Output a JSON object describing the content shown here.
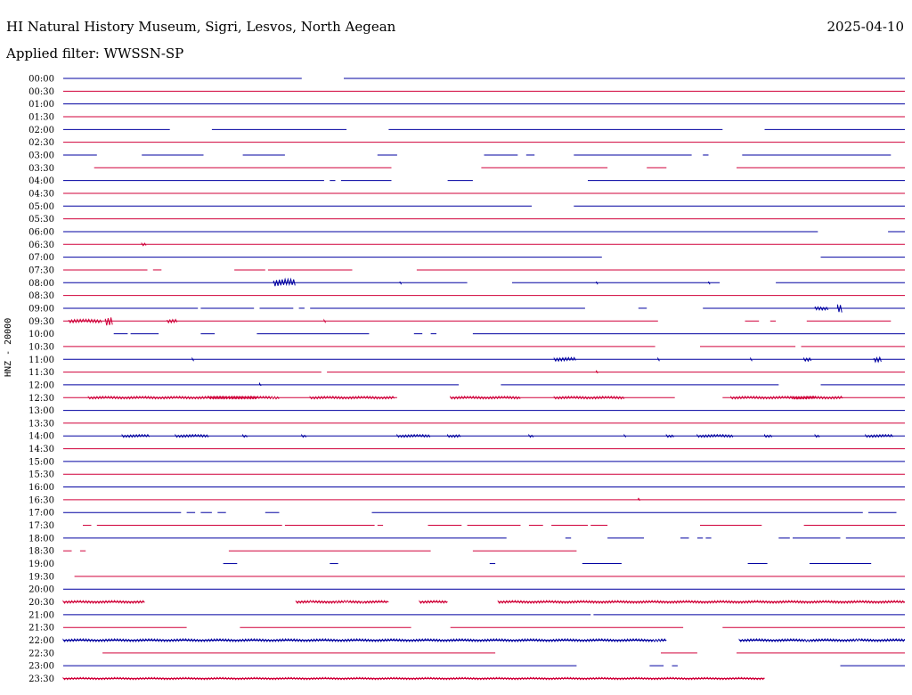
{
  "header": {
    "station": "HI Natural History Museum, Sigri, Lesvos, North Aegean",
    "date": "2025-04-10",
    "filter": "Applied filter: WWSSN-SP"
  },
  "colors": {
    "odd_row": "#0000a0",
    "even_row": "#d0003a"
  },
  "chart_data": {
    "type": "line",
    "title": "HI Natural History Museum, Sigri, Lesvos, North Aegean",
    "date": "2025-04-10",
    "ylabel": "HNZ - 20000",
    "x_range_minutes": [
      0,
      30
    ],
    "rows": [
      {
        "label": "00:00",
        "segments": [
          [
            0,
            8.5
          ],
          [
            10,
            30
          ]
        ],
        "bursts": []
      },
      {
        "label": "00:30",
        "segments": [
          [
            0,
            30
          ]
        ],
        "bursts": []
      },
      {
        "label": "01:00",
        "segments": [
          [
            0,
            30
          ]
        ],
        "bursts": []
      },
      {
        "label": "01:30",
        "segments": [
          [
            0,
            30
          ]
        ],
        "bursts": []
      },
      {
        "label": "02:00",
        "segments": [
          [
            0,
            3.8
          ],
          [
            5.3,
            10.1
          ],
          [
            11.6,
            23.5
          ],
          [
            25,
            30
          ]
        ],
        "bursts": []
      },
      {
        "label": "02:30",
        "segments": [
          [
            0,
            30
          ]
        ],
        "bursts": []
      },
      {
        "label": "03:00",
        "segments": [
          [
            0,
            1.2
          ],
          [
            2.8,
            5
          ],
          [
            6.4,
            7.9
          ],
          [
            11.2,
            11.9
          ],
          [
            15,
            16.2
          ],
          [
            16.5,
            16.8
          ],
          [
            18.2,
            22.4
          ],
          [
            22.8,
            23
          ],
          [
            24.2,
            29.5
          ]
        ],
        "bursts": []
      },
      {
        "label": "03:30",
        "segments": [
          [
            1.1,
            11.7
          ],
          [
            14.9,
            19.4
          ],
          [
            20.8,
            21.5
          ],
          [
            24,
            30
          ]
        ],
        "bursts": []
      },
      {
        "label": "04:00",
        "segments": [
          [
            0,
            9.3
          ],
          [
            9.5,
            9.7
          ],
          [
            9.9,
            11.7
          ],
          [
            13.7,
            14.6
          ],
          [
            18.7,
            30
          ]
        ],
        "bursts": []
      },
      {
        "label": "04:30",
        "segments": [
          [
            0,
            30
          ]
        ],
        "bursts": []
      },
      {
        "label": "05:00",
        "segments": [
          [
            0,
            16.7
          ],
          [
            18.2,
            30
          ]
        ],
        "bursts": []
      },
      {
        "label": "05:30",
        "segments": [
          [
            0,
            30
          ]
        ],
        "bursts": []
      },
      {
        "label": "06:00",
        "segments": [
          [
            0,
            26.9
          ],
          [
            29.4,
            30
          ]
        ],
        "bursts": []
      },
      {
        "label": "06:30",
        "segments": [
          [
            0,
            30
          ]
        ],
        "bursts": [
          [
            2.8,
            0.2,
            1.5
          ]
        ]
      },
      {
        "label": "07:00",
        "segments": [
          [
            0,
            19.2
          ],
          [
            27,
            30
          ]
        ],
        "bursts": []
      },
      {
        "label": "07:30",
        "segments": [
          [
            0,
            3
          ],
          [
            3.2,
            3.5
          ],
          [
            6.1,
            7.2
          ],
          [
            7.3,
            10.3
          ],
          [
            12.6,
            30
          ]
        ],
        "bursts": []
      },
      {
        "label": "08:00",
        "segments": [
          [
            0,
            14.4
          ],
          [
            16,
            23.4
          ],
          [
            25.4,
            30
          ]
        ],
        "bursts": [
          [
            7.5,
            0.8,
            4
          ],
          [
            12,
            0.1,
            2
          ],
          [
            19,
            0.1,
            2
          ],
          [
            23,
            0.1,
            2
          ]
        ]
      },
      {
        "label": "08:30",
        "segments": [
          [
            0,
            30
          ]
        ],
        "bursts": []
      },
      {
        "label": "09:00",
        "segments": [
          [
            0,
            4.8
          ],
          [
            4.9,
            6.8
          ],
          [
            7,
            8.2
          ],
          [
            8.4,
            8.6
          ],
          [
            8.8,
            18.6
          ],
          [
            20.5,
            20.8
          ],
          [
            22.8,
            30
          ]
        ],
        "bursts": [
          [
            26.8,
            0.5,
            2
          ],
          [
            27.6,
            0.2,
            5
          ]
        ]
      },
      {
        "label": "09:30",
        "segments": [
          [
            0,
            21.2
          ],
          [
            24.3,
            24.8
          ],
          [
            25.2,
            25.4
          ],
          [
            26.5,
            29.5
          ]
        ],
        "bursts": [
          [
            0.2,
            1.2,
            2
          ],
          [
            1.5,
            0.3,
            5
          ],
          [
            3.7,
            0.4,
            2
          ],
          [
            9.3,
            0.1,
            2
          ]
        ]
      },
      {
        "label": "10:00",
        "segments": [
          [
            1.8,
            2.3
          ],
          [
            2.4,
            3.4
          ],
          [
            4.9,
            5.4
          ],
          [
            6.9,
            10.9
          ],
          [
            12.5,
            12.8
          ],
          [
            13.1,
            13.3
          ],
          [
            14.6,
            30
          ]
        ],
        "bursts": []
      },
      {
        "label": "10:30",
        "segments": [
          [
            0,
            21.1
          ],
          [
            22.7,
            26.1
          ],
          [
            26.3,
            30
          ]
        ],
        "bursts": []
      },
      {
        "label": "11:00",
        "segments": [
          [
            0,
            30
          ]
        ],
        "bursts": [
          [
            4.6,
            0.1,
            2
          ],
          [
            17.5,
            0.8,
            2
          ],
          [
            21.2,
            0.1,
            2
          ],
          [
            24.5,
            0.1,
            2
          ],
          [
            26.4,
            0.3,
            2
          ],
          [
            28.9,
            0.3,
            3
          ]
        ]
      },
      {
        "label": "11:30",
        "segments": [
          [
            0,
            9.2
          ],
          [
            9.4,
            30
          ]
        ],
        "bursts": [
          [
            19,
            0.1,
            2
          ]
        ]
      },
      {
        "label": "12:00",
        "segments": [
          [
            0,
            14.1
          ],
          [
            15.6,
            25.5
          ],
          [
            27,
            30
          ]
        ],
        "bursts": [
          [
            7,
            0.1,
            1.5
          ]
        ]
      },
      {
        "label": "12:30",
        "segments": [
          [
            0,
            7.4
          ],
          [
            7.6,
            11.9
          ],
          [
            13.8,
            21.8
          ],
          [
            23.5,
            30
          ]
        ],
        "bursts": [
          [
            0.9,
            6,
            1.5
          ],
          [
            5.2,
            2.5,
            1.5
          ],
          [
            8.8,
            3,
            1.5
          ],
          [
            13.8,
            2.5,
            1.5
          ],
          [
            17.5,
            2.5,
            1.5
          ],
          [
            23.8,
            3,
            1.5
          ],
          [
            26,
            1.8,
            1.5
          ]
        ]
      },
      {
        "label": "13:00",
        "segments": [
          [
            0,
            30
          ]
        ],
        "bursts": []
      },
      {
        "label": "13:30",
        "segments": [
          [
            0,
            30
          ]
        ],
        "bursts": []
      },
      {
        "label": "14:00",
        "segments": [
          [
            0,
            30
          ]
        ],
        "bursts": [
          [
            2.1,
            1,
            1.5
          ],
          [
            4,
            1.2,
            1.5
          ],
          [
            6.4,
            0.2,
            1.5
          ],
          [
            8.5,
            0.2,
            1.5
          ],
          [
            11.9,
            1.2,
            1.5
          ],
          [
            13.7,
            0.5,
            1.5
          ],
          [
            16.6,
            0.2,
            1.5
          ],
          [
            20,
            0.1,
            1.5
          ],
          [
            21.5,
            0.3,
            1.5
          ],
          [
            22.6,
            1.3,
            1.5
          ],
          [
            25,
            0.3,
            1.5
          ],
          [
            26.8,
            0.2,
            1.5
          ],
          [
            28.6,
            1,
            1.5
          ]
        ]
      },
      {
        "label": "14:30",
        "segments": [
          [
            0,
            30
          ]
        ],
        "bursts": []
      },
      {
        "label": "15:00",
        "segments": [
          [
            0,
            30
          ]
        ],
        "bursts": []
      },
      {
        "label": "15:30",
        "segments": [
          [
            0,
            30
          ]
        ],
        "bursts": []
      },
      {
        "label": "16:00",
        "segments": [
          [
            0,
            30
          ]
        ],
        "bursts": []
      },
      {
        "label": "16:30",
        "segments": [
          [
            0,
            30
          ]
        ],
        "bursts": [
          [
            20.5,
            0.1,
            2
          ]
        ]
      },
      {
        "label": "17:00",
        "segments": [
          [
            0,
            4.2
          ],
          [
            4.4,
            4.7
          ],
          [
            4.9,
            5.3
          ],
          [
            5.5,
            5.8
          ],
          [
            7.2,
            7.7
          ],
          [
            11,
            28.5
          ],
          [
            28.7,
            29.7
          ]
        ],
        "bursts": []
      },
      {
        "label": "17:30",
        "segments": [
          [
            0.7,
            1
          ],
          [
            1.2,
            7.8
          ],
          [
            7.9,
            11.1
          ],
          [
            11.2,
            11.4
          ],
          [
            13,
            14.2
          ],
          [
            14.4,
            16.3
          ],
          [
            16.6,
            17.1
          ],
          [
            17.4,
            18.7
          ],
          [
            18.8,
            19.4
          ],
          [
            22.7,
            24.9
          ],
          [
            26.4,
            30
          ]
        ],
        "bursts": []
      },
      {
        "label": "18:00",
        "segments": [
          [
            0,
            15.8
          ],
          [
            17.9,
            18.1
          ],
          [
            19.4,
            20.7
          ],
          [
            22,
            22.3
          ],
          [
            22.6,
            22.8
          ],
          [
            22.9,
            23.1
          ],
          [
            25.5,
            25.9
          ],
          [
            26,
            27.7
          ],
          [
            27.9,
            30
          ]
        ],
        "bursts": []
      },
      {
        "label": "18:30",
        "segments": [
          [
            0,
            0.3
          ],
          [
            0.6,
            0.8
          ],
          [
            5.9,
            13.1
          ],
          [
            14.6,
            18.3
          ]
        ],
        "bursts": []
      },
      {
        "label": "19:00",
        "segments": [
          [
            5.7,
            6.2
          ],
          [
            9.5,
            9.8
          ],
          [
            15.2,
            15.4
          ],
          [
            18.5,
            19.9
          ],
          [
            24.4,
            25.1
          ],
          [
            26.6,
            28.8
          ]
        ],
        "bursts": []
      },
      {
        "label": "19:30",
        "segments": [
          [
            0.4,
            30
          ]
        ],
        "bursts": []
      },
      {
        "label": "20:00",
        "segments": [
          [
            0,
            30
          ]
        ],
        "bursts": []
      },
      {
        "label": "20:30",
        "segments": [
          [
            0,
            2.9
          ],
          [
            8.3,
            8.8
          ],
          [
            8.9,
            9.7
          ],
          [
            9.8,
            10
          ],
          [
            10.2,
            10.6
          ],
          [
            10.7,
            11.6
          ],
          [
            12.7,
            13.7
          ],
          [
            15.5,
            30
          ]
        ],
        "bursts": [
          [
            0,
            2.9,
            1.5
          ],
          [
            8.3,
            3.3,
            1.5
          ],
          [
            12.7,
            1,
            1.5
          ],
          [
            15.5,
            14.5,
            1.5
          ]
        ]
      },
      {
        "label": "21:00",
        "segments": [
          [
            0,
            18.8
          ],
          [
            18.9,
            30
          ]
        ],
        "bursts": []
      },
      {
        "label": "21:30",
        "segments": [
          [
            0,
            4.4
          ],
          [
            6.3,
            12.4
          ],
          [
            13.8,
            22.1
          ],
          [
            23.5,
            30
          ]
        ],
        "bursts": []
      },
      {
        "label": "22:00",
        "segments": [
          [
            0,
            21
          ],
          [
            21.3,
            21.5
          ],
          [
            24.1,
            26.4
          ],
          [
            26.6,
            28.2
          ],
          [
            28.4,
            30
          ]
        ],
        "bursts": [
          [
            0,
            21.5,
            1.5
          ],
          [
            24.1,
            5.9,
            1.5
          ]
        ]
      },
      {
        "label": "22:30",
        "segments": [
          [
            1.4,
            15.4
          ],
          [
            21.3,
            22.6
          ],
          [
            24,
            30
          ]
        ],
        "bursts": []
      },
      {
        "label": "23:00",
        "segments": [
          [
            0,
            18.3
          ],
          [
            20.9,
            21.4
          ],
          [
            21.7,
            21.9
          ],
          [
            27.7,
            30
          ]
        ],
        "bursts": []
      },
      {
        "label": "23:30",
        "segments": [
          [
            0,
            25
          ]
        ],
        "bursts": [
          [
            0,
            25,
            1.2
          ]
        ]
      }
    ]
  }
}
